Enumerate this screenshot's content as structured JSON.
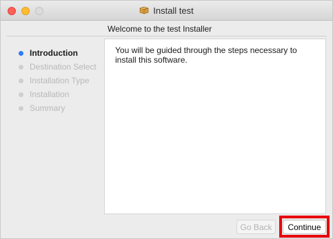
{
  "window": {
    "title": "Install test",
    "title_icon": "package-icon"
  },
  "page": {
    "subtitle": "Welcome to the test Installer"
  },
  "steps": [
    {
      "label": "Introduction",
      "state": "active"
    },
    {
      "label": "Destination Select",
      "state": "pending"
    },
    {
      "label": "Installation Type",
      "state": "pending"
    },
    {
      "label": "Installation",
      "state": "pending"
    },
    {
      "label": "Summary",
      "state": "pending"
    }
  ],
  "content": {
    "text": "You will be guided through the steps necessary to install this software."
  },
  "buttons": {
    "back_label": "Go Back",
    "continue_label": "Continue"
  },
  "colors": {
    "accent_dot": "#2f7cf6",
    "highlight": "#e8000b"
  }
}
